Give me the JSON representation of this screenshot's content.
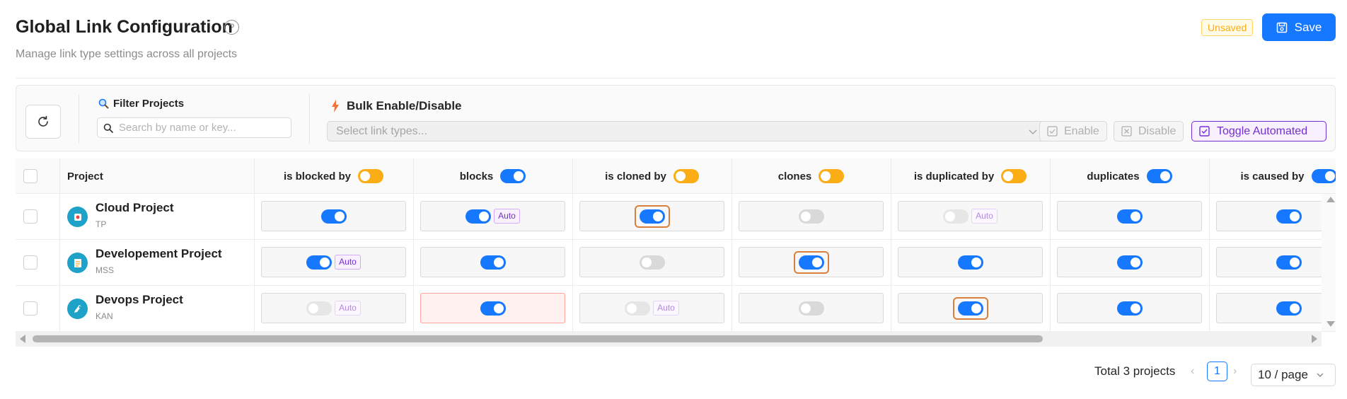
{
  "header": {
    "title": "Global Link Configuration",
    "subtitle": "Manage link type settings across all projects",
    "unsaved_badge": "Unsaved",
    "save_label": "Save"
  },
  "toolbar": {
    "filter_label": "Filter Projects",
    "search_placeholder": "Search by name or key...",
    "search_value": "",
    "bulk_label": "Bulk Enable/Disable",
    "select_placeholder": "Select link types...",
    "enable_label": "Enable",
    "disable_label": "Disable",
    "toggle_automated_label": "Toggle Automated"
  },
  "table": {
    "project_header": "Project",
    "columns": [
      {
        "label": "is blocked by",
        "header_toggle": "mixed"
      },
      {
        "label": "blocks",
        "header_toggle": "on"
      },
      {
        "label": "is cloned by",
        "header_toggle": "mixed"
      },
      {
        "label": "clones",
        "header_toggle": "mixed"
      },
      {
        "label": "is duplicated by",
        "header_toggle": "mixed"
      },
      {
        "label": "duplicates",
        "header_toggle": "on"
      },
      {
        "label": "is caused by",
        "header_toggle": "on"
      }
    ],
    "rows": [
      {
        "name": "Cloud Project",
        "key": "TP",
        "cells": [
          {
            "on": true,
            "auto": false,
            "highlight": false
          },
          {
            "on": true,
            "auto": true,
            "highlight": false
          },
          {
            "on": true,
            "auto": false,
            "highlight": true
          },
          {
            "on": false,
            "auto": false,
            "highlight": false
          },
          {
            "on": false,
            "auto": true,
            "highlight": false
          },
          {
            "on": true,
            "auto": false,
            "highlight": false
          },
          {
            "on": true,
            "auto": false,
            "highlight": false
          }
        ]
      },
      {
        "name": "Developement Project",
        "key": "MSS",
        "cells": [
          {
            "on": true,
            "auto": true,
            "highlight": false
          },
          {
            "on": true,
            "auto": false,
            "highlight": false
          },
          {
            "on": false,
            "auto": false,
            "highlight": false
          },
          {
            "on": true,
            "auto": false,
            "highlight": true
          },
          {
            "on": true,
            "auto": false,
            "highlight": false
          },
          {
            "on": true,
            "auto": false,
            "highlight": false
          },
          {
            "on": true,
            "auto": false,
            "highlight": false
          }
        ]
      },
      {
        "name": "Devops Project",
        "key": "KAN",
        "cells": [
          {
            "on": false,
            "auto": true,
            "highlight": false
          },
          {
            "on": true,
            "auto": false,
            "highlight": false,
            "warning": true
          },
          {
            "on": false,
            "auto": true,
            "highlight": false
          },
          {
            "on": false,
            "auto": false,
            "highlight": false
          },
          {
            "on": true,
            "auto": false,
            "highlight": true
          },
          {
            "on": true,
            "auto": false,
            "highlight": false
          },
          {
            "on": true,
            "auto": false,
            "highlight": false
          }
        ]
      }
    ],
    "auto_tag": "Auto"
  },
  "pagination": {
    "total_text": "Total 3 projects",
    "current_page": "1",
    "page_size": "10 / page"
  },
  "colors": {
    "primary": "#1677ff",
    "warning": "#faad14",
    "automated": "#722ed1",
    "highlight_border": "#d9813c"
  }
}
